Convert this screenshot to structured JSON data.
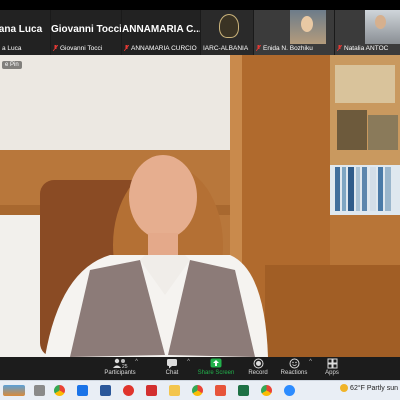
{
  "participants": [
    {
      "big": "iana Luca",
      "small": "a Luca"
    },
    {
      "big": "Giovanni Tocci",
      "small": "Giovanni Tocci"
    },
    {
      "big": "ANNAMARIA C...",
      "small": "ANNAMARIA CURCIO"
    },
    {
      "big": "",
      "small": "IARC-ALBANIA"
    },
    {
      "big": "",
      "small": "Enida N. Bozhiku"
    },
    {
      "big": "",
      "small": "Natalia ANTOC"
    }
  ],
  "video": {
    "pin_label": "e Pin"
  },
  "toolbar": [
    {
      "label": "Participants",
      "count": "25",
      "icon": "participants-icon"
    },
    {
      "label": "Chat",
      "icon": "chat-icon"
    },
    {
      "label": "Share Screen",
      "icon": "share-screen-icon"
    },
    {
      "label": "Record",
      "icon": "record-icon"
    },
    {
      "label": "Reactions",
      "icon": "reactions-icon"
    },
    {
      "label": "Apps",
      "icon": "apps-icon"
    }
  ],
  "taskbar": {
    "weather_temp": "62°F",
    "weather_text": "Partly sun",
    "apps": [
      "news-icon",
      "chrome-icon",
      "mail-icon",
      "word-icon",
      "opera-icon",
      "acrobat-icon",
      "file-explorer-icon",
      "chrome-icon",
      "office-icon",
      "excel-icon",
      "chrome-icon",
      "zoom-icon"
    ]
  },
  "colors": {
    "accent_green": "#22b14c",
    "toolbar_bg": "#1c1c1c",
    "mic_red": "#e53935"
  }
}
